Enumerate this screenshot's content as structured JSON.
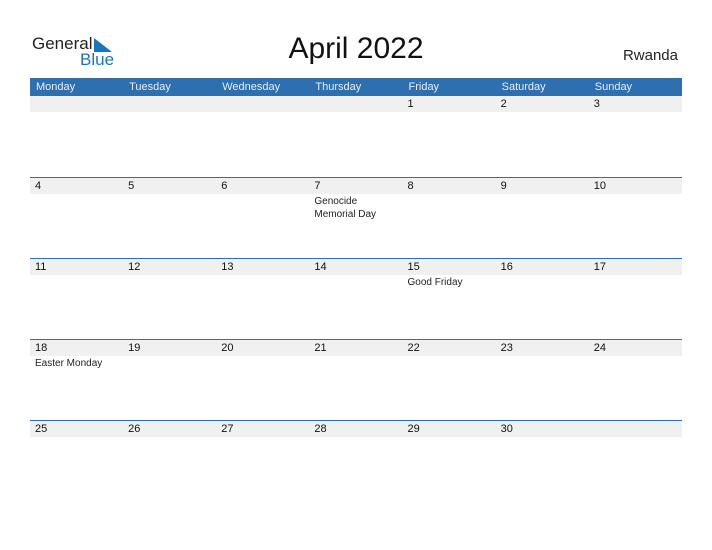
{
  "logo": {
    "word1": "General",
    "word2": "Blue"
  },
  "title": "April 2022",
  "country": "Rwanda",
  "weekdays": [
    "Monday",
    "Tuesday",
    "Wednesday",
    "Thursday",
    "Friday",
    "Saturday",
    "Sunday"
  ],
  "weeks": [
    [
      {
        "d": ""
      },
      {
        "d": ""
      },
      {
        "d": ""
      },
      {
        "d": ""
      },
      {
        "d": "1"
      },
      {
        "d": "2"
      },
      {
        "d": "3"
      }
    ],
    [
      {
        "d": "4"
      },
      {
        "d": "5"
      },
      {
        "d": "6"
      },
      {
        "d": "7",
        "ev": "Genocide Memorial Day"
      },
      {
        "d": "8"
      },
      {
        "d": "9"
      },
      {
        "d": "10"
      }
    ],
    [
      {
        "d": "11"
      },
      {
        "d": "12"
      },
      {
        "d": "13"
      },
      {
        "d": "14"
      },
      {
        "d": "15",
        "ev": "Good Friday"
      },
      {
        "d": "16"
      },
      {
        "d": "17"
      }
    ],
    [
      {
        "d": "18",
        "ev": "Easter Monday"
      },
      {
        "d": "19"
      },
      {
        "d": "20"
      },
      {
        "d": "21"
      },
      {
        "d": "22"
      },
      {
        "d": "23"
      },
      {
        "d": "24"
      }
    ],
    [
      {
        "d": "25"
      },
      {
        "d": "26"
      },
      {
        "d": "27"
      },
      {
        "d": "28"
      },
      {
        "d": "29"
      },
      {
        "d": "30"
      },
      {
        "d": ""
      }
    ]
  ]
}
